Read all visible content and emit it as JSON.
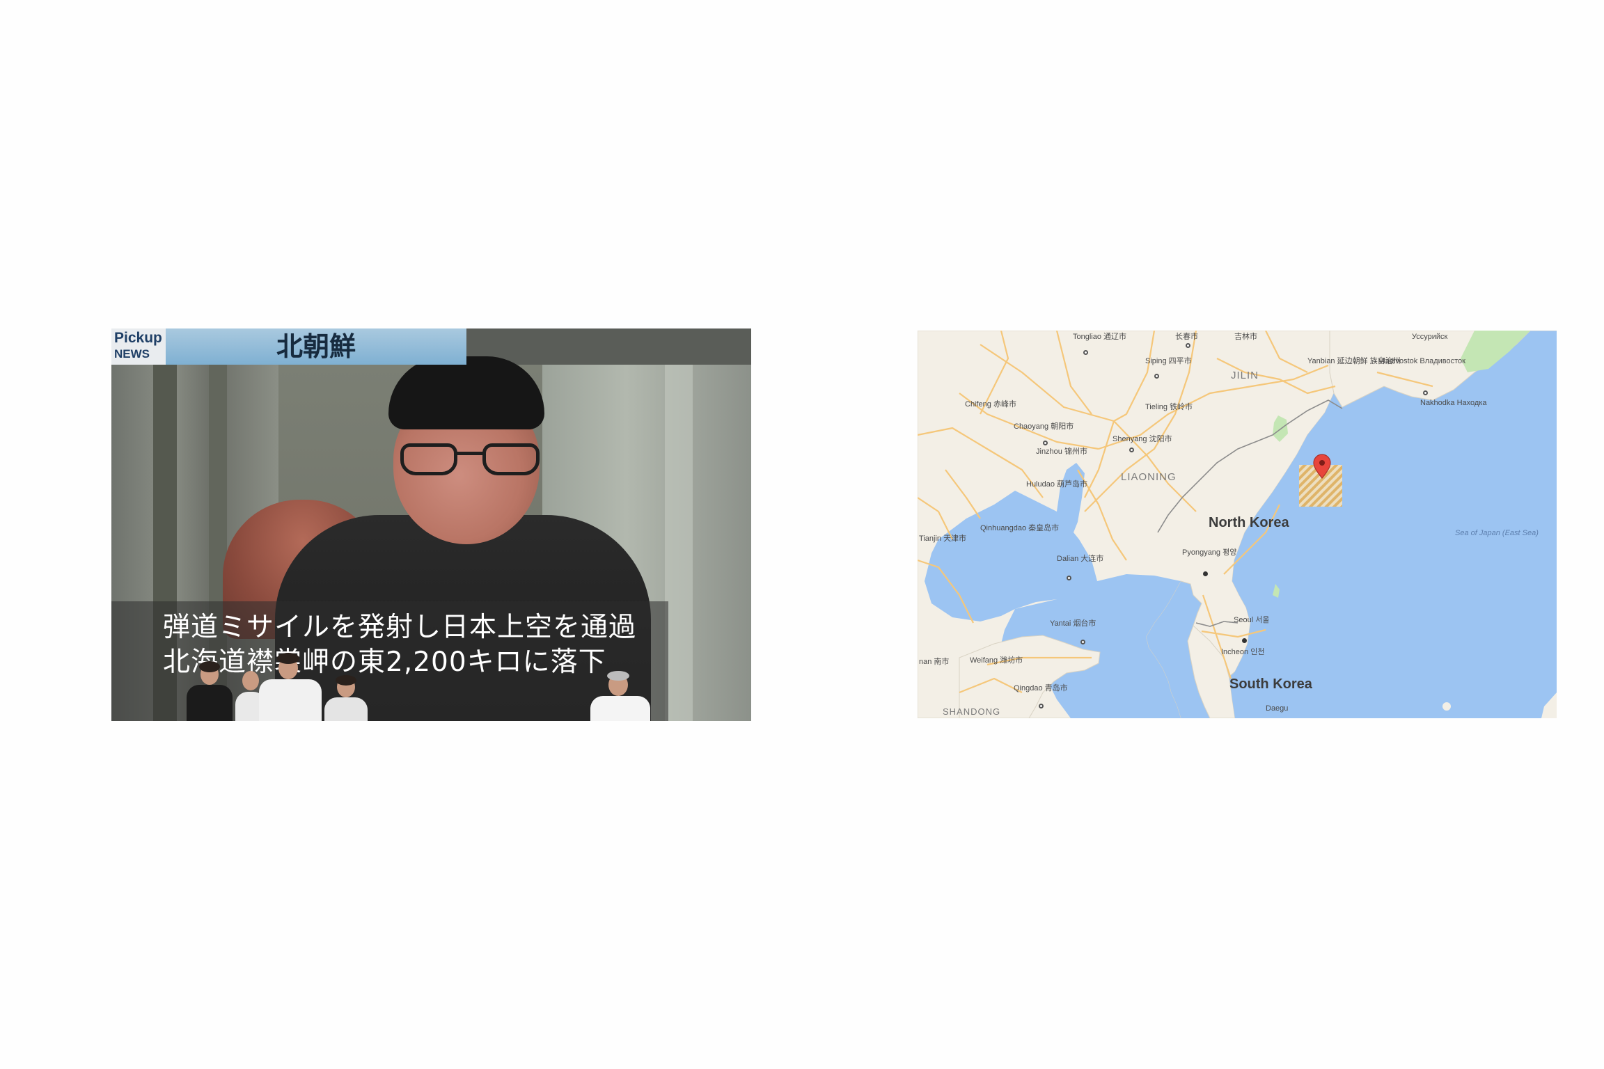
{
  "news_photo": {
    "logo_line1": "Pickup",
    "logo_line2": "NEWS",
    "banner_title": "北朝鮮",
    "ticker_line1": "弾道ミサイルを発射し日本上空を通過",
    "ticker_line2": "北海道襟裳岬の東2,200キロに落下"
  },
  "map": {
    "country_labels": {
      "north_korea": "North Korea",
      "south_korea": "South Korea"
    },
    "region_labels": {
      "jilin": "JILIN",
      "liaoning": "LIAONING",
      "shandong": "SHANDONG"
    },
    "sea_label": {
      "line1": "Sea of Japan",
      "line2": "(East Sea)"
    },
    "cities": {
      "tongliao": [
        "Tongliao",
        "通辽市"
      ],
      "changchun": [
        "长春市"
      ],
      "jilin_city": [
        "吉林市"
      ],
      "siping": [
        "Siping",
        "四平市"
      ],
      "yanbian": [
        "Yanbian",
        "延边朝鲜",
        "族自治州"
      ],
      "vladivostok": [
        "Vladivostok",
        "Владивосток"
      ],
      "ussuriysk": [
        "Уссурийск"
      ],
      "nakhodka": [
        "Nakhodka",
        "Находка"
      ],
      "chifeng": [
        "Chifeng",
        "赤峰市"
      ],
      "chaoyang": [
        "Chaoyang",
        "朝阳市"
      ],
      "tieling": [
        "Tieling",
        "铁岭市"
      ],
      "shenyang": [
        "Shenyang",
        "沈阳市"
      ],
      "jinzhou": [
        "Jinzhou",
        "锦州市"
      ],
      "huludao": [
        "Huludao",
        "葫芦岛市"
      ],
      "qinhuangdao": [
        "Qinhuangdao",
        "秦皇岛市"
      ],
      "tianjin": [
        "Tianjin",
        "天津市"
      ],
      "dalian": [
        "Dalian",
        "大连市"
      ],
      "pyongyang": [
        "Pyongyang",
        "평양"
      ],
      "yantai": [
        "Yantai",
        "烟台市"
      ],
      "weifang": [
        "Weifang",
        "潍坊市"
      ],
      "jinan": [
        "nan",
        "南市"
      ],
      "qingdao": [
        "Qingdao",
        "青岛市"
      ],
      "seoul": [
        "Seoul",
        "서울"
      ],
      "incheon": [
        "Incheon",
        "인천"
      ],
      "daegu": [
        "Daegu"
      ]
    },
    "colors": {
      "water": "#9cc4f2",
      "land": "#f3efe6",
      "roads": "#f5c77a",
      "marker": "#e8453c",
      "hatch_area": "#e6b25a"
    }
  }
}
